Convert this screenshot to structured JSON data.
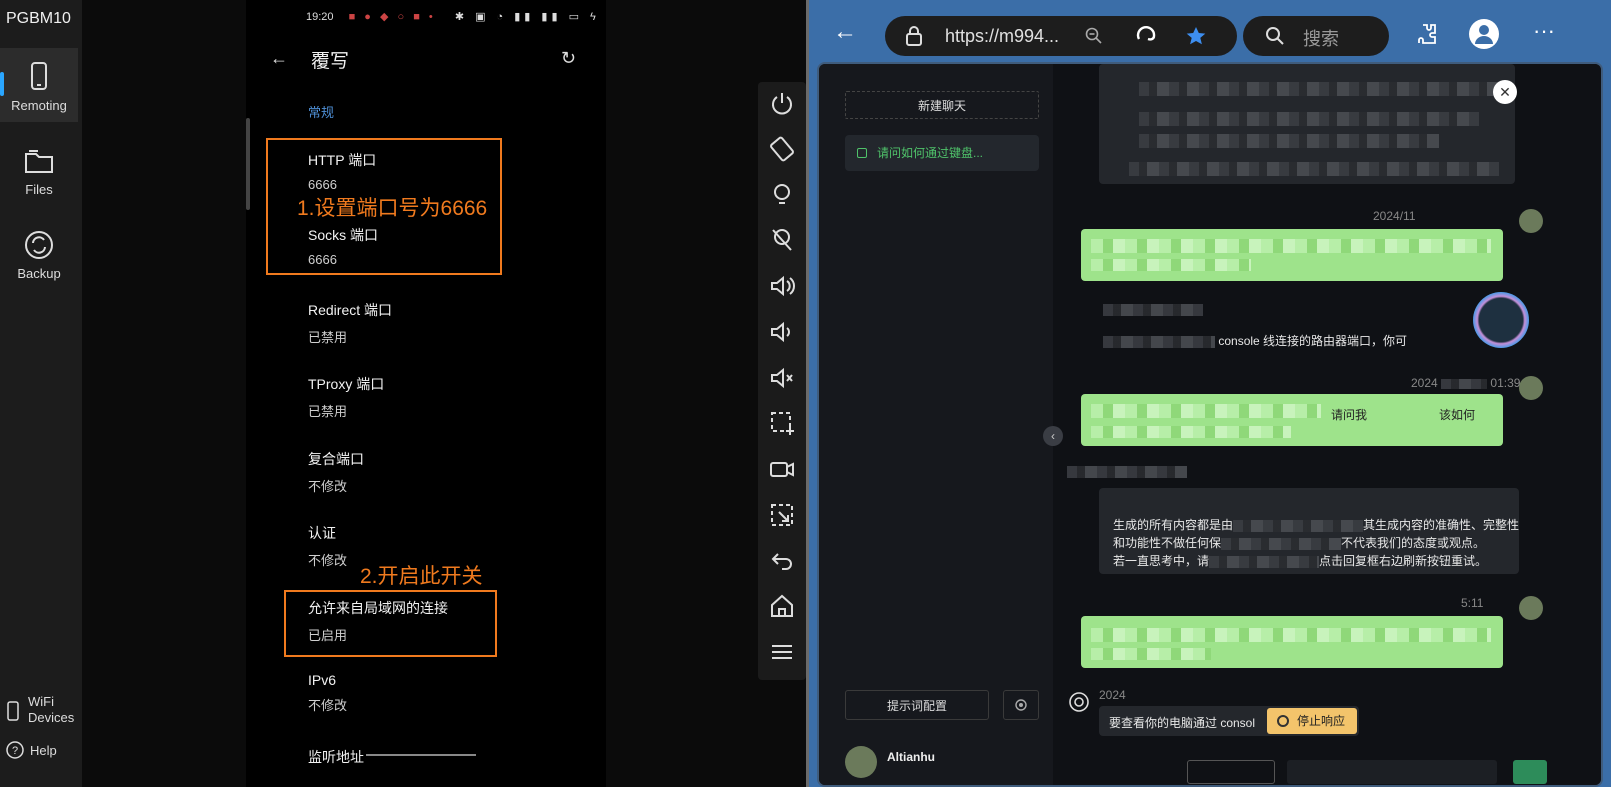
{
  "app": {
    "title": "PGBM10",
    "nav": [
      {
        "label": "Remoting",
        "icon": "phone-icon"
      },
      {
        "label": "Files",
        "icon": "folder-icon"
      },
      {
        "label": "Backup",
        "icon": "sync-icon"
      }
    ],
    "bottom": [
      {
        "label": "WiFi\nDevices",
        "icon": "wifi-devices-icon"
      },
      {
        "label": "Help",
        "icon": "help-icon"
      }
    ]
  },
  "phone": {
    "status_time": "19:20",
    "title": "覆写",
    "section": "常规",
    "prefs": [
      {
        "title": "HTTP 端口",
        "value": "6666"
      },
      {
        "title": "Socks 端口",
        "value": "6666"
      },
      {
        "title": "Redirect 端口",
        "value": "已禁用"
      },
      {
        "title": "TProxy 端口",
        "value": "已禁用"
      },
      {
        "title": "复合端口",
        "value": "不修改"
      },
      {
        "title": "认证",
        "value": "不修改"
      },
      {
        "title": "允许来自局域网的连接",
        "value": "已启用"
      },
      {
        "title": "IPv6",
        "value": "不修改"
      },
      {
        "title": "监听地址",
        "value": ""
      }
    ]
  },
  "annotations": {
    "step1": "1.设置端口号为6666",
    "step2": "2.开启此开关",
    "color": "#f07a1e"
  },
  "browser": {
    "url": "https://m994...",
    "search_placeholder": "搜索",
    "sidebar": {
      "new_chat": "新建聊天",
      "chat_item": "请问如何通过键盘...",
      "prompt_config": "提示词配置",
      "user": "Altianhu"
    },
    "chat": {
      "snippet_1": "console 线连接的路由器端口，你可",
      "snippet_2": "生成的所有内容都是由",
      "snippet_3": "其生成内容的准确性、完整性",
      "snippet_4": "和功能性不做任何保",
      "snippet_5": "不代表我们的态度或观点。",
      "snippet_6": "若一直思考中，请",
      "snippet_7": "点击回复框右边刷新按钮重试。",
      "snippet_8": "要查看你的电脑通过 consol",
      "snippet_9": "请问我",
      "snippet_10": "该如何",
      "stamp_1": "2024/11",
      "stamp_2": "2024",
      "stamp_3": "01:39",
      "stamp_4": "5:11",
      "stamp_5": "2024",
      "stop": "停止响应"
    }
  }
}
